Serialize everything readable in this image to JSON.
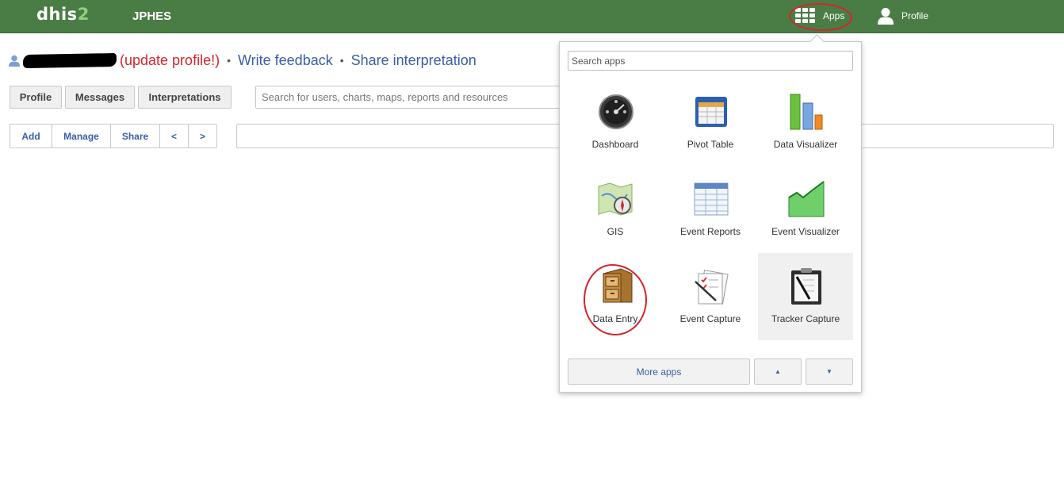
{
  "header": {
    "logo": "dhis",
    "logo_suffix": "2",
    "instance": "JPHES",
    "apps_label": "Apps",
    "profile_label": "Profile"
  },
  "user_line": {
    "update_profile": "(update profile!)",
    "write_feedback": "Write feedback",
    "share_interpretation": "Share interpretation",
    "separator": "•"
  },
  "tabs": [
    "Profile",
    "Messages",
    "Interpretations"
  ],
  "search": {
    "placeholder": "Search for users, charts, maps, reports and resources"
  },
  "actions": [
    "Add",
    "Manage",
    "Share",
    "<",
    ">"
  ],
  "apps_menu": {
    "search_placeholder": "Search apps",
    "apps": [
      {
        "name": "Dashboard",
        "icon": "dashboard-icon"
      },
      {
        "name": "Pivot Table",
        "icon": "pivot-table-icon"
      },
      {
        "name": "Data Visualizer",
        "icon": "data-visualizer-icon"
      },
      {
        "name": "GIS",
        "icon": "gis-icon"
      },
      {
        "name": "Event Reports",
        "icon": "event-reports-icon"
      },
      {
        "name": "Event Visualizer",
        "icon": "event-visualizer-icon"
      },
      {
        "name": "Data Entry",
        "icon": "data-entry-icon"
      },
      {
        "name": "Event Capture",
        "icon": "event-capture-icon"
      },
      {
        "name": "Tracker Capture",
        "icon": "tracker-capture-icon"
      }
    ],
    "more_apps": "More apps",
    "up_arrow": "▲",
    "down_arrow": "▼"
  },
  "colors": {
    "header_bg": "#4a7d45",
    "link": "#3a5ea6",
    "alert_red": "#d4252c"
  }
}
